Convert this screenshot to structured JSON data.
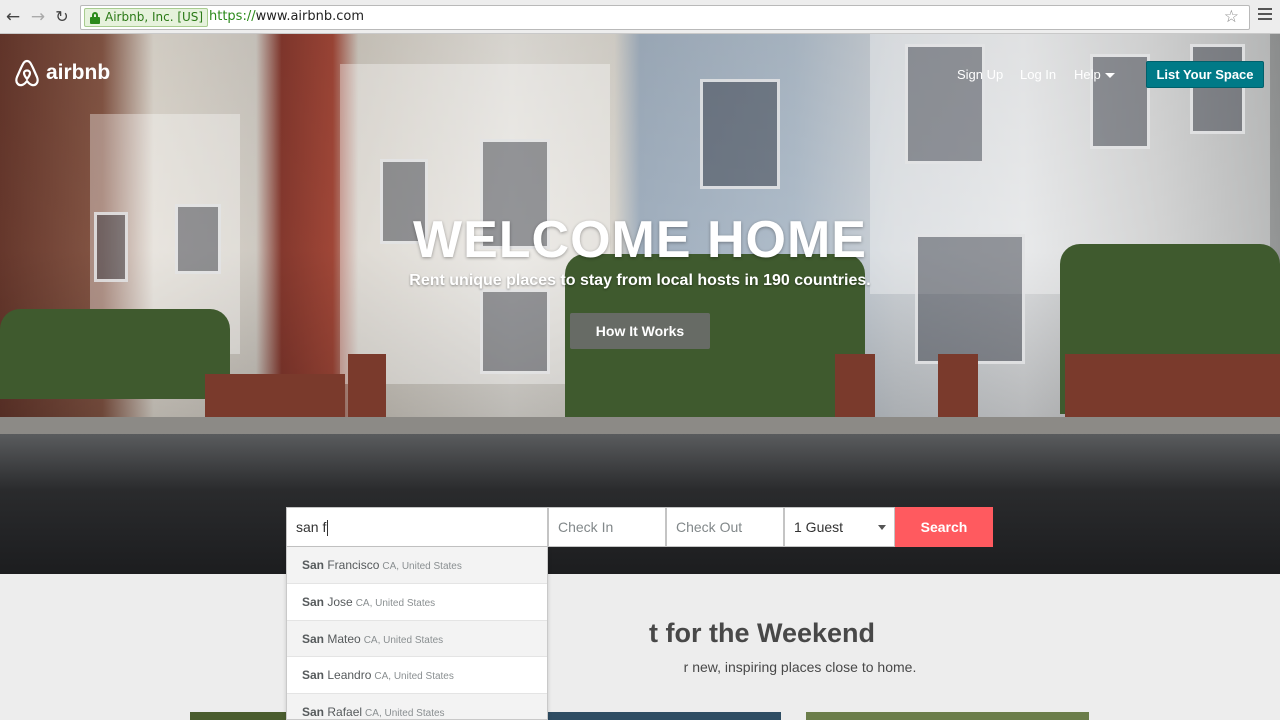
{
  "browser": {
    "security_label": "Airbnb, Inc. [US]",
    "url_scheme": "https://",
    "url_host": "www.airbnb.com",
    "icons": [
      "back-arrow",
      "forward-arrow",
      "reload",
      "lock",
      "star",
      "hamburger-menu"
    ]
  },
  "header": {
    "logo_text": "airbnb",
    "nav": {
      "signup": "Sign Up",
      "login": "Log In",
      "help": "Help"
    },
    "list_space": "List Your Space",
    "accent": "#007a87"
  },
  "hero": {
    "title": "WELCOME HOME",
    "subtitle": "Rent unique places to stay from local hosts in 190 countries.",
    "cta": "How It Works"
  },
  "search": {
    "where_value": "san f",
    "checkin_placeholder": "Check In",
    "checkout_placeholder": "Check Out",
    "guests": "1 Guest",
    "button": "Search",
    "button_color": "#ff5a5f"
  },
  "autocomplete": [
    {
      "match": "San",
      "rest": " Francisco",
      "region": "CA, United States"
    },
    {
      "match": "San",
      "rest": " Jose",
      "region": "CA, United States"
    },
    {
      "match": "San",
      "rest": " Mateo",
      "region": "CA, United States"
    },
    {
      "match": "San",
      "rest": " Leandro",
      "region": "CA, United States"
    },
    {
      "match": "San",
      "rest": " Rafael",
      "region": "CA, United States"
    }
  ],
  "lower": {
    "title_partial": "t for the Weekend",
    "subtitle_partial": "r new, inspiring places close to home."
  }
}
